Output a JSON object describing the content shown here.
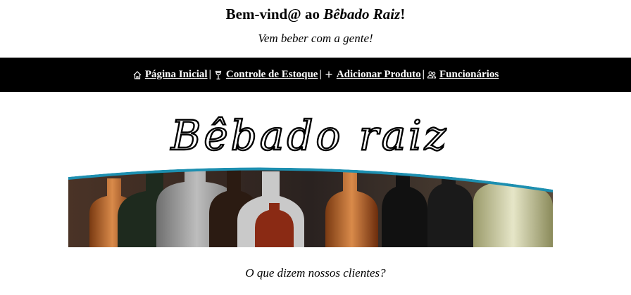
{
  "header": {
    "welcome_prefix": "Bem-vind@ ao ",
    "welcome_brand": "Bêbado Raiz",
    "welcome_suffix": "!",
    "tagline": "Vem beber com a gente!"
  },
  "nav": {
    "items": [
      {
        "label": "Página Inicial",
        "icon": "house-icon"
      },
      {
        "label": "Controle de Estoque",
        "icon": "wine-glass-icon"
      },
      {
        "label": "Adicionar Produto",
        "icon": "plus-icon"
      },
      {
        "label": "Funcionários",
        "icon": "people-icon"
      }
    ],
    "separator": "|"
  },
  "logo": {
    "text": "Bêbado raiz"
  },
  "banner": {
    "description_icon": "bottles-banner",
    "arc_color": "#1d8fb0"
  },
  "testimonials": {
    "heading": "O que dizem nossos clientes?"
  },
  "colors": {
    "navbar_bg": "#000000",
    "navbar_text": "#ffffff"
  }
}
